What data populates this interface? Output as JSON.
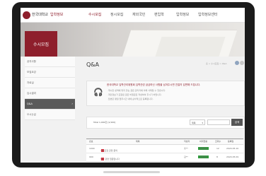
{
  "header": {
    "logo_text": "한국대학교",
    "logo_sub": "입학정보",
    "nav": [
      "수시모집",
      "정시모집",
      "재외국민",
      "편입학",
      "입학정보",
      "입학정보센터"
    ],
    "active_nav_index": 0
  },
  "banner": {
    "heading": "수시모집"
  },
  "sidebar": {
    "items": [
      {
        "label": "공지사항",
        "active": false
      },
      {
        "label": "모집요강",
        "active": false
      },
      {
        "label": "자료실",
        "active": false
      },
      {
        "label": "입시결과",
        "active": false
      },
      {
        "label": "Q&A",
        "active": true
      },
      {
        "label": "오시는길",
        "active": false
      }
    ]
  },
  "page": {
    "title": "Q&A",
    "breadcrumb": "홈 > 수시모집 > Q&A"
  },
  "notice": {
    "title": "한국대학교 입학관리위원회 입학관련 궁금하신 사항을 남겨주시면 친절히 답변해 드립니다.",
    "lines": [
      "· 게시판 성격에 맞지 않는 글은 관리자에 의해 삭제될 수 있습니다.",
      "· 개인정보가 포함된 글은 비밀글로 작성하여 주시기 바랍니다.",
      "· 답변은 평일 업무시간 내에 순차적으로 등록됩니다."
    ]
  },
  "search": {
    "total_text": "Total 1,000건 [1/100]",
    "select_value": "제목",
    "button_label": "검색"
  },
  "table": {
    "headers": [
      "번호",
      "제목",
      "작성자",
      "처리현황",
      "조회수",
      "등록일"
    ],
    "rows": [
      {
        "num": "1000",
        "title": "수시모집 관련 문의",
        "badge": "N",
        "author": "홍**",
        "status": "답변완료",
        "views": "12",
        "date": "2024.05.10"
      },
      {
        "num": "999",
        "title": "입학 관련 질문입니다",
        "badge": "N",
        "author": "김**",
        "status": "답변완료",
        "views": "8",
        "date": "2024.05.09"
      }
    ]
  },
  "colors": {
    "brand": "#8e1f2c",
    "status_green": "#2f9b3c",
    "badge_red": "#d6303f"
  }
}
